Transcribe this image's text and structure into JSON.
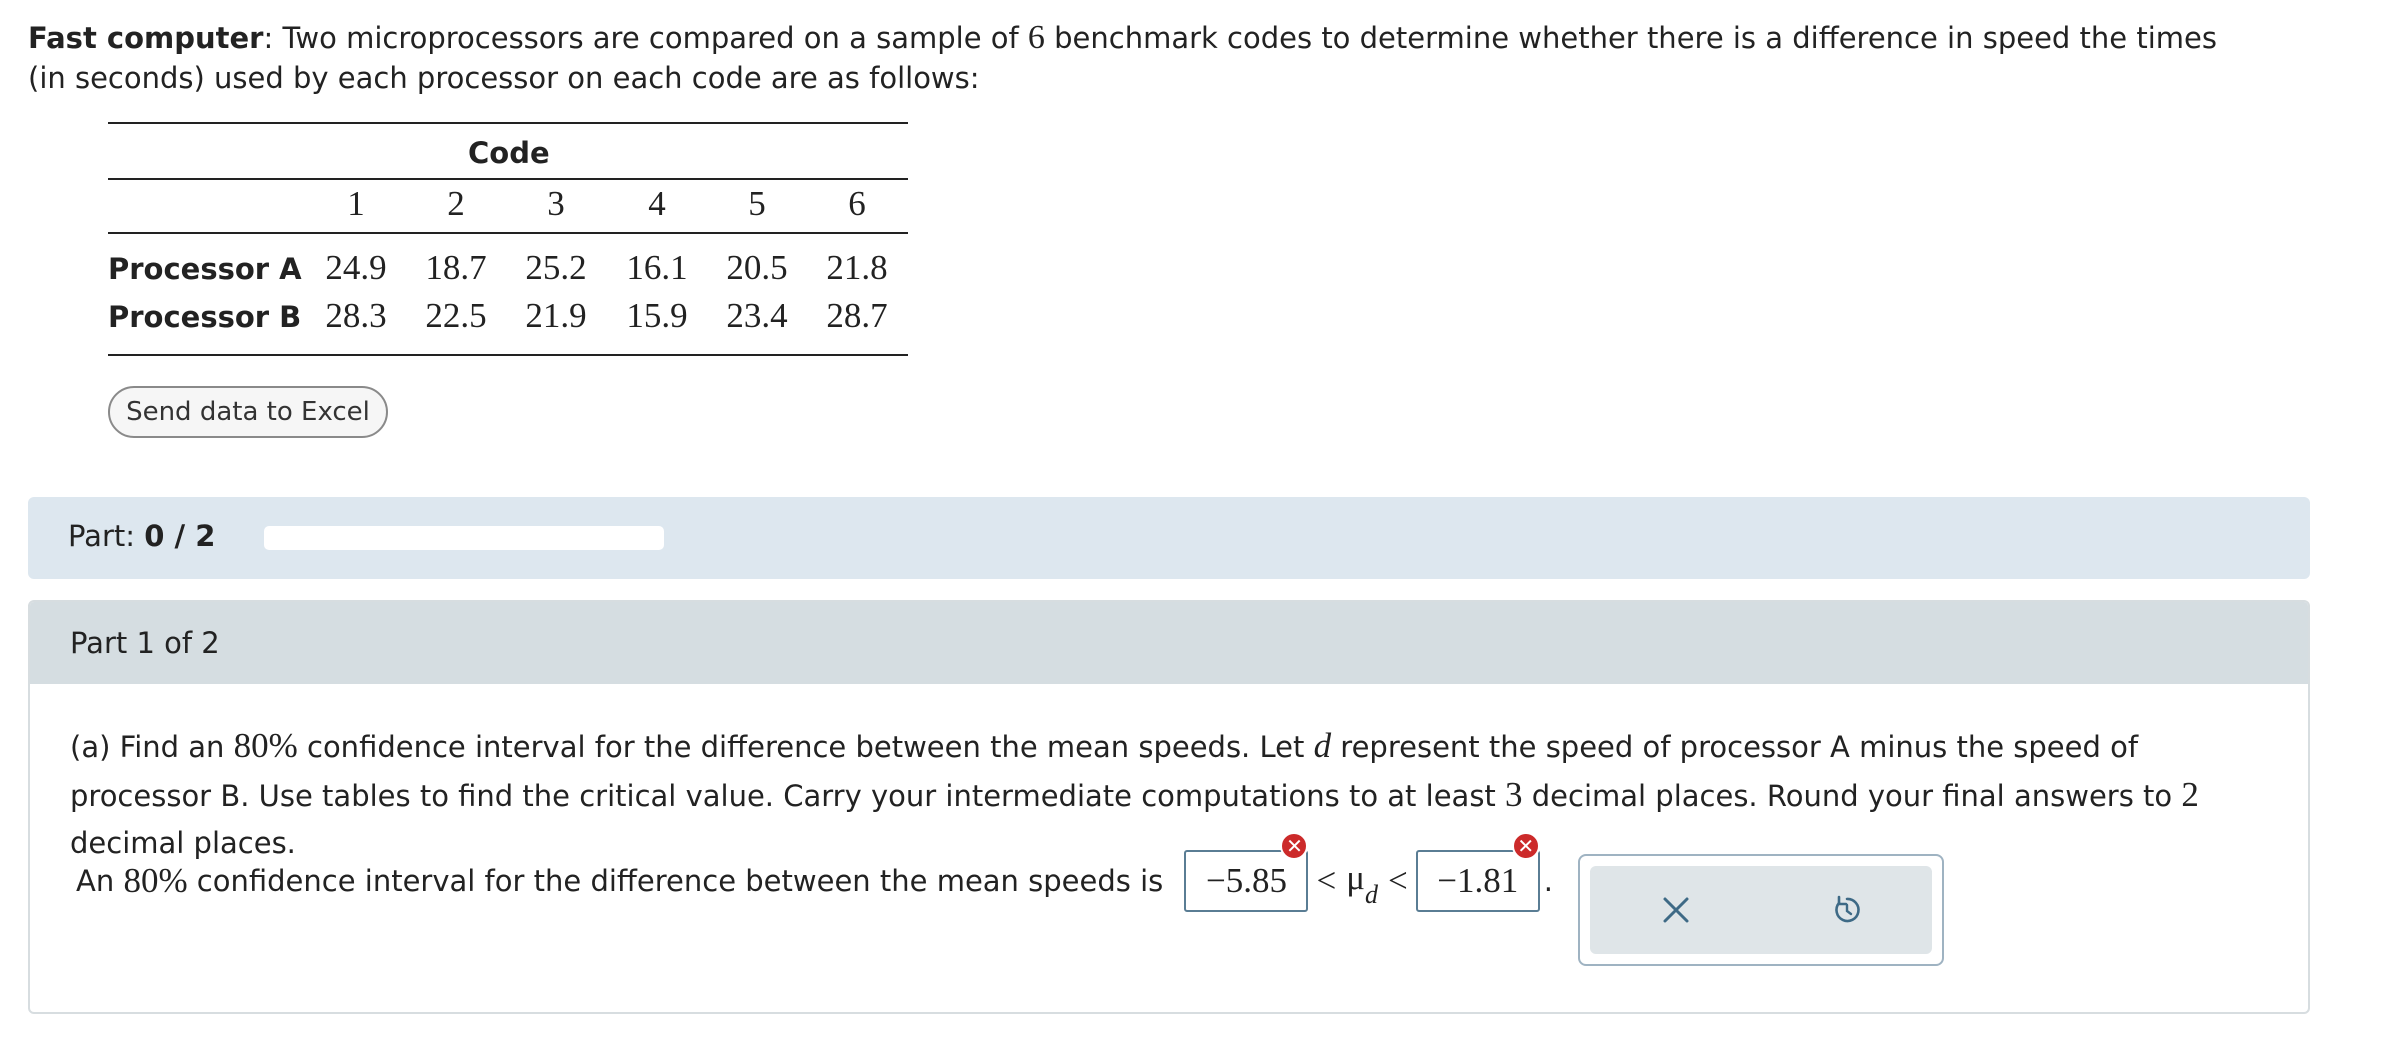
{
  "intro": {
    "bold_title": "Fast computer",
    "text_before_n": ": Two microprocessors are compared on a sample of ",
    "n": "6",
    "text_after_n": " benchmark codes to determine whether there is a difference in speed the times (in seconds) used by each processor on each code are as follows:"
  },
  "table": {
    "header": "Code",
    "codes": [
      "1",
      "2",
      "3",
      "4",
      "5",
      "6"
    ],
    "rows": [
      {
        "label": "Processor A",
        "values": [
          "24.9",
          "18.7",
          "25.2",
          "16.1",
          "20.5",
          "21.8"
        ]
      },
      {
        "label": "Processor B",
        "values": [
          "28.3",
          "22.5",
          "21.9",
          "15.9",
          "23.4",
          "28.7"
        ]
      }
    ]
  },
  "excel_button": "Send data to Excel",
  "part_bar": {
    "label": "Part:",
    "value": "0 / 2",
    "progress": 0
  },
  "part": {
    "title": "Part 1 of 2",
    "question_a": "(a) Find an ",
    "pct": "80%",
    "question_b": " confidence interval for the difference between the mean speeds. Let ",
    "var_d": "d",
    "question_c": " represent the speed of processor A minus the speed of processor B. Use tables to find the critical value. Carry your intermediate computations to at least ",
    "decimals_inter": "3",
    "question_d": " decimal places. Round your final answers to ",
    "decimals_final": "2",
    "question_e": " decimal places."
  },
  "answer": {
    "prefix": "An ",
    "pct": "80%",
    "middle": " confidence interval for the difference between the mean speeds is ",
    "lower": "−5.85",
    "upper": "−1.81",
    "lt1": "<",
    "mu": "μ",
    "mu_sub": "d",
    "lt2": "<",
    "period": "."
  },
  "colors": {
    "part_bar_bg": "#dde7ef",
    "part_head_bg": "#d5dde1",
    "error_red": "#cc2a2a",
    "action_bg": "#dfe5e8"
  },
  "icons": {
    "error": "error-x-icon",
    "clear": "close-icon",
    "retry": "retry-icon"
  }
}
